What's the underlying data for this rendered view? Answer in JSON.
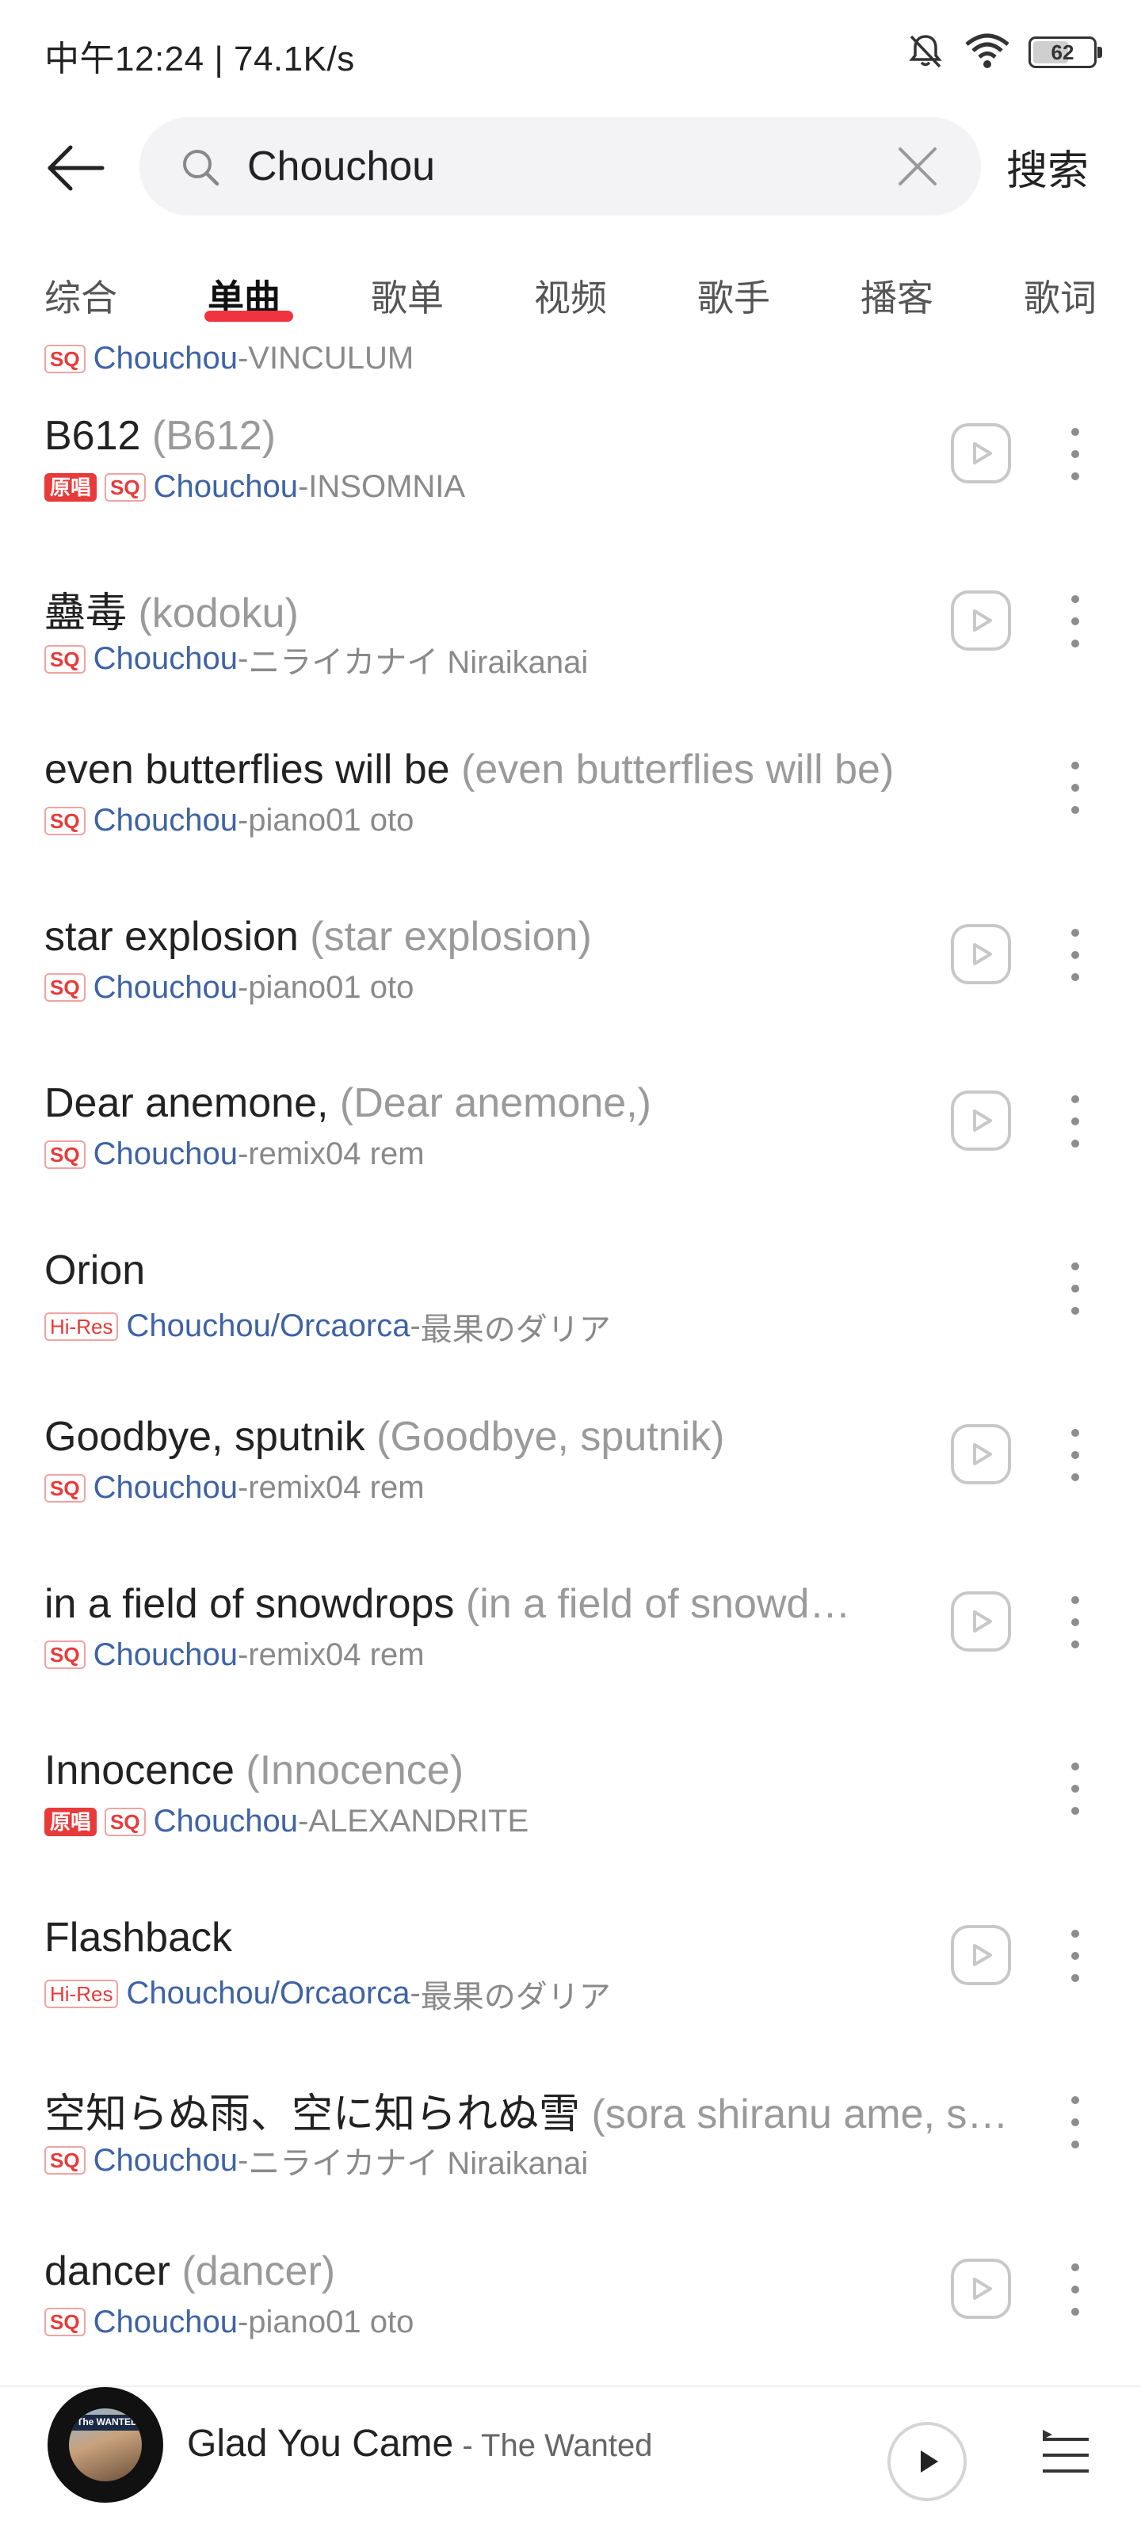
{
  "status_bar": {
    "time_speed": "中午12:24 | 74.1K/s",
    "battery": "62",
    "battery_fraction": 0.62
  },
  "search": {
    "query": "Chouchou",
    "placeholder": "",
    "submit_label": "搜索"
  },
  "tabs": [
    {
      "label": "综合"
    },
    {
      "label": "单曲"
    },
    {
      "label": "歌单"
    },
    {
      "label": "视频"
    },
    {
      "label": "歌手"
    },
    {
      "label": "播客"
    },
    {
      "label": "歌词"
    }
  ],
  "active_tab": "单曲",
  "partial_row": {
    "badge": "SQ",
    "artist": "Chouchou",
    "sep": " - ",
    "album": "VINCULUM"
  },
  "songs": [
    {
      "title": "B612",
      "alt": "(B612)",
      "badges": [
        "原唱",
        "SQ"
      ],
      "artist": "Chouchou",
      "album": "INSOMNIA",
      "play": true
    },
    {
      "title": "蠱毒",
      "alt": "(kodoku)",
      "badges": [
        "SQ"
      ],
      "artist": "Chouchou",
      "album": "ニライカナイ Niraikanai",
      "play": true
    },
    {
      "title": "even butterflies will be",
      "alt": "(even butterflies will be)",
      "badges": [
        "SQ"
      ],
      "artist": "Chouchou",
      "album": "piano01 oto",
      "play": false
    },
    {
      "title": "star explosion",
      "alt": "(star explosion)",
      "badges": [
        "SQ"
      ],
      "artist": "Chouchou",
      "album": "piano01 oto",
      "play": true
    },
    {
      "title": "Dear anemone,",
      "alt": "(Dear anemone,)",
      "badges": [
        "SQ"
      ],
      "artist": "Chouchou",
      "album": "remix04 rem",
      "play": true
    },
    {
      "title": "Orion",
      "alt": "",
      "badges": [
        "Hi-Res"
      ],
      "artist": "Chouchou",
      "artist2": "/Orcaorca",
      "album": "最果のダリア",
      "play": false
    },
    {
      "title": "Goodbye, sputnik",
      "alt": "(Goodbye, sputnik)",
      "badges": [
        "SQ"
      ],
      "artist": "Chouchou",
      "album": "remix04 rem",
      "play": true
    },
    {
      "title": "in a field of snowdrops",
      "alt": "(in a field of snowd…",
      "badges": [
        "SQ"
      ],
      "artist": "Chouchou",
      "album": "remix04 rem",
      "play": true
    },
    {
      "title": "Innocence",
      "alt": "(Innocence)",
      "badges": [
        "原唱",
        "SQ"
      ],
      "artist": "Chouchou",
      "album": "ALEXANDRITE",
      "play": false
    },
    {
      "title": "Flashback",
      "alt": "",
      "badges": [
        "Hi-Res"
      ],
      "artist": "Chouchou",
      "artist2": "/Orcaorca",
      "album": "最果のダリア",
      "play": true
    },
    {
      "title": "空知らぬ雨、空に知られぬ雪",
      "alt": "(sora shiranu ame, s…",
      "badges": [
        "SQ"
      ],
      "artist": "Chouchou",
      "album": "ニライカナイ Niraikanai",
      "play": false
    },
    {
      "title": "dancer",
      "alt": "(dancer)",
      "badges": [
        "SQ"
      ],
      "artist": "Chouchou",
      "album": "piano01 oto",
      "play": true
    }
  ],
  "meta_separator": " - ",
  "player": {
    "title": "Glad You Came",
    "artist": " - The Wanted",
    "art_text": "The WANTED"
  },
  "colors": {
    "accent": "#f0343f",
    "artist_link": "#3e63a6",
    "badge_red": "#e83a3a"
  },
  "icons": {
    "back": "arrow-left-icon",
    "search": "search-icon",
    "clear": "close-icon",
    "play": "play-icon",
    "more": "more-vertical-icon",
    "playlist": "playlist-icon",
    "silent": "bell-off-icon",
    "wifi": "wifi-icon"
  }
}
